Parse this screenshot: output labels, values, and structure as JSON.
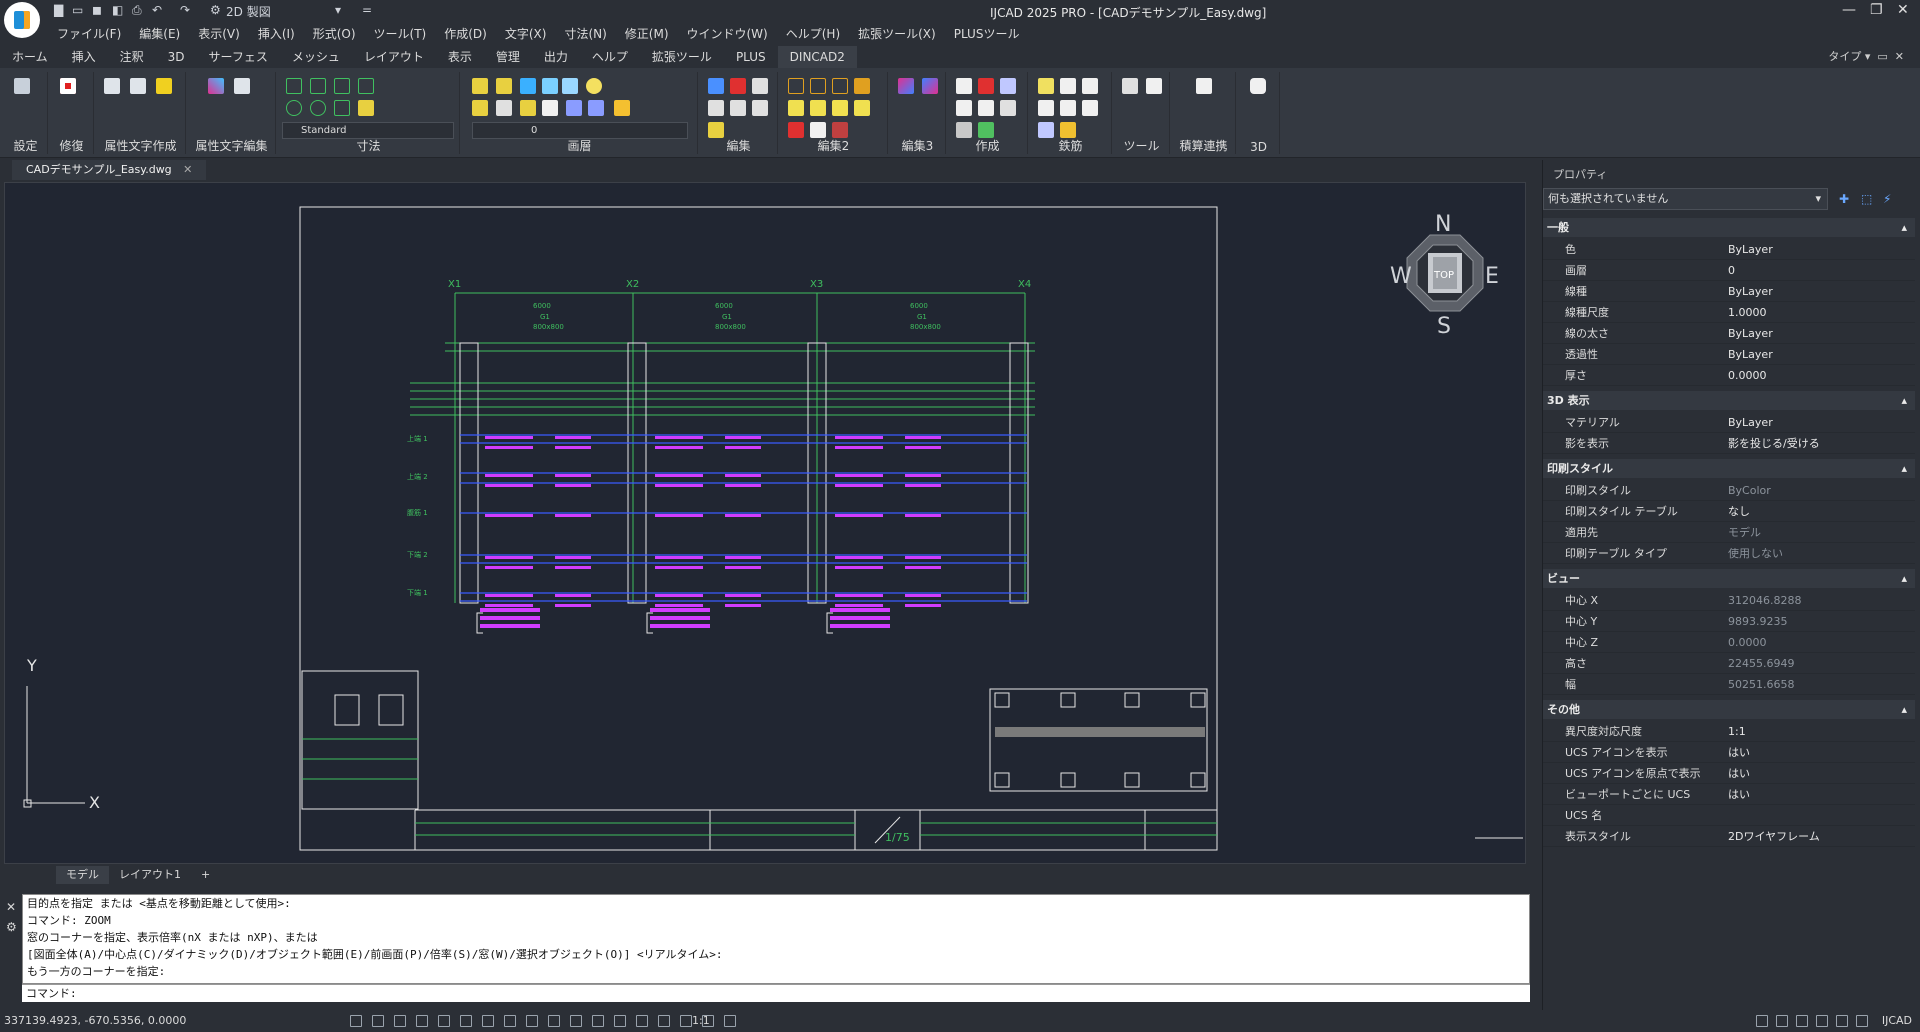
{
  "app": {
    "title": "IJCAD 2025 PRO - [CADデモサンプル_Easy.dwg]",
    "workspace": "2D 製図"
  },
  "menu": [
    "ファイル(F)",
    "編集(E)",
    "表示(V)",
    "挿入(I)",
    "形式(O)",
    "ツール(T)",
    "作成(D)",
    "文字(X)",
    "寸法(N)",
    "修正(M)",
    "ウインドウ(W)",
    "ヘルプ(H)",
    "拡張ツール(X)",
    "PLUSツール"
  ],
  "ribbon_tabs": [
    "ホーム",
    "挿入",
    "注釈",
    "3D",
    "サーフェス",
    "メッシュ",
    "レイアウト",
    "表示",
    "管理",
    "出力",
    "ヘルプ",
    "拡張ツール",
    "PLUS",
    "DINCAD2"
  ],
  "ribbon_tab_active": "DINCAD2",
  "type_dropdown": "タイプ",
  "ribbon_panels": [
    "設定",
    "修復",
    "属性文字作成",
    "属性文字編集",
    "寸法",
    "画層",
    "編集",
    "編集2",
    "編集3",
    "作成",
    "鉄筋",
    "ツール",
    "積算連携",
    "3D"
  ],
  "dim_style": "Standard",
  "layer_value": "0",
  "document_tab": "CADデモサンプル_Easy.dwg",
  "layout_tabs": [
    "モデル",
    "レイアウト1",
    "+"
  ],
  "navcube": {
    "n": "N",
    "s": "S",
    "e": "E",
    "w": "W",
    "top": "TOP"
  },
  "ucs": {
    "x": "X",
    "y": "Y"
  },
  "command_history": [
    "目的点を指定 または <基点を移動距離として使用>:",
    "コマンド: ZOOM",
    "窓のコーナーを指定、表示倍率(nX または nXP)、または",
    "[図面全体(A)/中心点(C)/ダイナミック(D)/オブジェクト範囲(E)/前画面(P)/倍率(S)/窓(W)/選択オブジェクト(O)] <リアルタイム>:",
    "もう一方のコーナーを指定:"
  ],
  "command_prompt": "コマンド:",
  "status": {
    "coords": "337139.4923, -670.5356, 0.0000",
    "scale": "1:1",
    "brand": "IJCAD"
  },
  "properties": {
    "title": "プロパティ",
    "selection": "何も選択されていません",
    "sections": [
      {
        "name": "一般",
        "rows": [
          {
            "k": "色",
            "v": "ByLayer"
          },
          {
            "k": "画層",
            "v": "0"
          },
          {
            "k": "線種",
            "v": "ByLayer"
          },
          {
            "k": "線種尺度",
            "v": "1.0000"
          },
          {
            "k": "線の太さ",
            "v": "ByLayer"
          },
          {
            "k": "透過性",
            "v": "ByLayer"
          },
          {
            "k": "厚さ",
            "v": "0.0000"
          }
        ]
      },
      {
        "name": "3D 表示",
        "rows": [
          {
            "k": "マテリアル",
            "v": "ByLayer"
          },
          {
            "k": "影を表示",
            "v": "影を投じる/受ける"
          }
        ]
      },
      {
        "name": "印刷スタイル",
        "rows": [
          {
            "k": "印刷スタイル",
            "v": "ByColor"
          },
          {
            "k": "印刷スタイル テーブル",
            "v": "なし"
          },
          {
            "k": "適用先",
            "v": "モデル"
          },
          {
            "k": "印刷テーブル タイプ",
            "v": "使用しない"
          }
        ]
      },
      {
        "name": "ビュー",
        "rows": [
          {
            "k": "中心 X",
            "v": "312046.8288"
          },
          {
            "k": "中心 Y",
            "v": "9893.9235"
          },
          {
            "k": "中心 Z",
            "v": "0.0000"
          },
          {
            "k": "高さ",
            "v": "22455.6949"
          },
          {
            "k": "幅",
            "v": "50251.6658"
          }
        ]
      },
      {
        "name": "その他",
        "rows": [
          {
            "k": "異尺度対応尺度",
            "v": "1:1"
          },
          {
            "k": "UCS アイコンを表示",
            "v": "はい"
          },
          {
            "k": "UCS アイコンを原点で表示",
            "v": "はい"
          },
          {
            "k": "ビューポートごとに UCS",
            "v": "はい"
          },
          {
            "k": "UCS 名",
            "v": ""
          },
          {
            "k": "表示スタイル",
            "v": "2Dワイヤフレーム"
          }
        ]
      }
    ]
  },
  "drawing": {
    "grid_labels": [
      "X1",
      "X2",
      "X3",
      "X4"
    ],
    "row_labels": [
      "上端 1",
      "上端 2",
      "腹筋 1",
      "下端 2",
      "下端 1"
    ],
    "sheet_number": "1/75",
    "spans": [
      "6000",
      "6000",
      "6000"
    ],
    "beam_marks": [
      "G1",
      "G1",
      "G1"
    ],
    "beam_sizes": [
      "800x800",
      "800x800",
      "800x800"
    ]
  },
  "colors": {
    "bg": "#2b2f36",
    "ribbon": "#343941",
    "viewport": "#212632",
    "cad_green": "#3fbf5f",
    "cad_blue": "#3a5bff",
    "cad_magenta": "#d23cff",
    "frame": "#e6e6e6"
  }
}
